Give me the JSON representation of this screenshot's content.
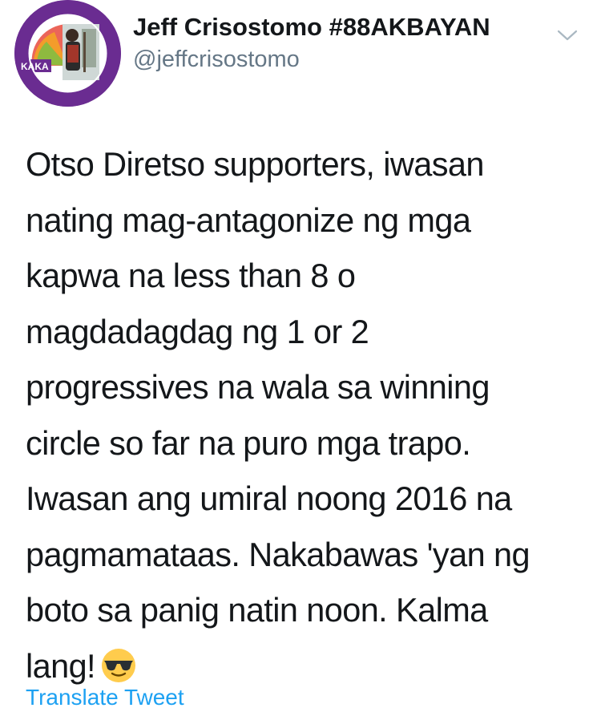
{
  "tweet": {
    "author": {
      "display_name": "Jeff Crisostomo #88AKBAYAN",
      "handle": "@jeffcrisostomo",
      "avatar_badge_text": "KAKA"
    },
    "text_lines": [
      "Otso Diretso supporters, iwasan",
      "nating mag-antagonize ng mga",
      "kapwa na less than 8 o",
      "magdadagdag ng 1 or 2",
      "progressives na wala sa winning",
      "circle so far na puro mga trapo.",
      "Iwasan ang umiral noong 2016 na",
      "pagmamataas. Nakabawas 'yan ng",
      "boto sa panig natin noon. Kalma",
      "lang!"
    ],
    "emoji": "sunglasses-emoji",
    "translate_label": "Translate Tweet"
  },
  "colors": {
    "text": "#14171a",
    "secondary": "#657786",
    "link": "#1da1f2",
    "avatar_ring": "#6a2c91"
  },
  "icons": {
    "caret": "chevron-down-icon"
  }
}
